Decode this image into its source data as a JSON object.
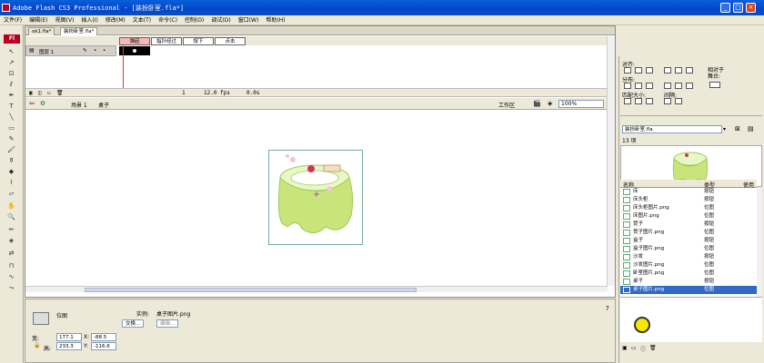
{
  "window": {
    "title": "Adobe Flash CS3 Professional - [装扮卧室.fla*]"
  },
  "menu": [
    "文件(F)",
    "编辑(E)",
    "视图(V)",
    "插入(I)",
    "修改(M)",
    "文本(T)",
    "命令(C)",
    "控制(O)",
    "调试(D)",
    "窗口(W)",
    "帮助(H)"
  ],
  "app_logo": "Fl",
  "tabs": [
    "ok1.fla*",
    "装扮卧室.fla*"
  ],
  "timeline": {
    "frame_labels": [
      "弹起",
      "指针经过",
      "按下",
      "点击"
    ],
    "layer_name": "图层 1",
    "status": {
      "frame": "1",
      "fps": "12.0 fps",
      "time": "0.0s"
    }
  },
  "edit_bar": {
    "scene": "场景 1",
    "symbol": "桌子",
    "workspace": "工作区",
    "zoom": "100%"
  },
  "properties": {
    "type_label": "位图",
    "instance_label": "实例:",
    "instance_name": "桌子图片.png",
    "swap_button": "交换...",
    "edit_button": "编辑...",
    "w_label": "宽:",
    "w_value": "177.1",
    "h_label": "高:",
    "h_value": "233.3",
    "x_label": "X:",
    "x_value": "-88.5",
    "y_label": "Y:",
    "y_value": "-116.6"
  },
  "align_panel": {
    "title": "对齐:",
    "distribute": "分布:",
    "match_size": "匹配大小:",
    "spacing": "间隔:",
    "to_stage": "相对于\n舞台:"
  },
  "library": {
    "doc_select": "装扮卧室.fla",
    "count": "13 项",
    "headers": {
      "name": "名称",
      "kind": "类型",
      "use": "使用"
    },
    "items": [
      {
        "name": "床",
        "kind": "按钮"
      },
      {
        "name": "床头柜",
        "kind": "按钮"
      },
      {
        "name": "床头柜图片.png",
        "kind": "位图"
      },
      {
        "name": "床图片.png",
        "kind": "位图"
      },
      {
        "name": "凳子",
        "kind": "按钮"
      },
      {
        "name": "凳子图片.png",
        "kind": "位图"
      },
      {
        "name": "盒子",
        "kind": "按钮"
      },
      {
        "name": "盒子图片.png",
        "kind": "位图"
      },
      {
        "name": "沙发",
        "kind": "按钮"
      },
      {
        "name": "沙发图片.png",
        "kind": "位图"
      },
      {
        "name": "卧室图片.png",
        "kind": "位图"
      },
      {
        "name": "桌子",
        "kind": "按钮"
      },
      {
        "name": "桌子图片.png",
        "kind": "位图"
      }
    ],
    "selected_index": 12
  },
  "colors": {
    "title_bar": "#0346c9",
    "selection": "#316ac5",
    "accent": "#b8001c",
    "cursor": "#f5e800"
  }
}
